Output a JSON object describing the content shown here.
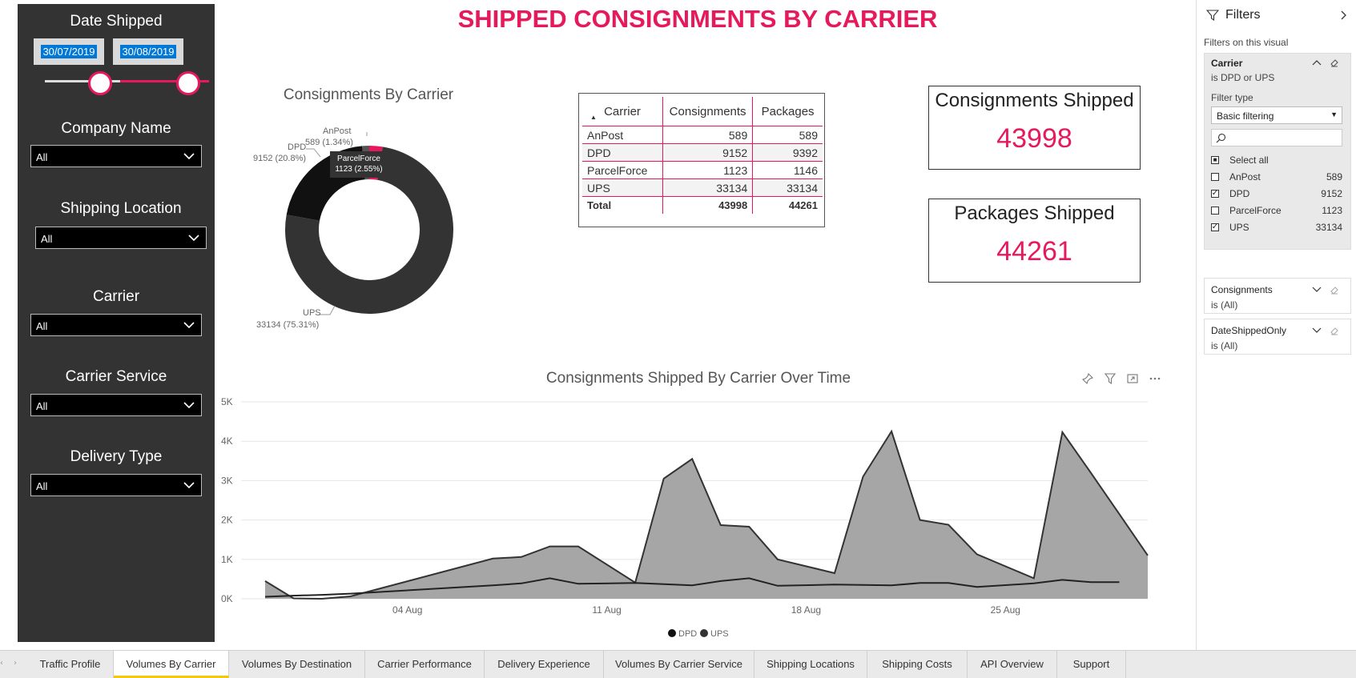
{
  "page_title": "SHIPPED CONSIGNMENTS BY CARRIER",
  "slicers": {
    "date_shipped": {
      "label": "Date Shipped",
      "start": "30/07/2019",
      "end": "30/08/2019"
    },
    "company_name": {
      "label": "Company Name",
      "value": "All"
    },
    "shipping_location": {
      "label": "Shipping Location",
      "value": "All"
    },
    "carrier": {
      "label": "Carrier",
      "value": "All"
    },
    "carrier_service": {
      "label": "Carrier Service",
      "value": "All"
    },
    "delivery_type": {
      "label": "Delivery Type",
      "value": "All"
    }
  },
  "donut": {
    "title": "Consignments By Carrier",
    "tooltip_name": "ParcelForce",
    "tooltip_value": "1123 (2.55%)",
    "labels": {
      "anpost_name": "AnPost",
      "anpost_value": "589 (1.34%)",
      "dpd_name": "DPD",
      "dpd_value": "9152 (20.8%)",
      "ups_name": "UPS",
      "ups_value": "33134 (75.31%)"
    }
  },
  "table": {
    "headers": [
      "Carrier",
      "Consignments",
      "Packages"
    ],
    "rows": [
      {
        "carrier": "AnPost",
        "consignments": "589",
        "packages": "589"
      },
      {
        "carrier": "DPD",
        "consignments": "9152",
        "packages": "9392"
      },
      {
        "carrier": "ParcelForce",
        "consignments": "1123",
        "packages": "1146"
      },
      {
        "carrier": "UPS",
        "consignments": "33134",
        "packages": "33134"
      }
    ],
    "total": {
      "label": "Total",
      "consignments": "43998",
      "packages": "44261"
    }
  },
  "kpis": {
    "consignments": {
      "label": "Consignments Shipped",
      "value": "43998"
    },
    "packages": {
      "label": "Packages Shipped",
      "value": "44261"
    }
  },
  "area_chart": {
    "title": "Consignments Shipped By Carrier Over Time",
    "legend": [
      "DPD",
      "UPS"
    ]
  },
  "chart_data": {
    "type": "area",
    "title": "Consignments Shipped By Carrier Over Time",
    "x_ticks": [
      "04 Aug",
      "11 Aug",
      "18 Aug",
      "25 Aug"
    ],
    "y_ticks": [
      "0K",
      "1K",
      "2K",
      "3K",
      "4K",
      "5K"
    ],
    "ylim": [
      0,
      5000
    ],
    "x": [
      "30 Jul",
      "31 Jul",
      "01 Aug",
      "02 Aug",
      "07 Aug",
      "08 Aug",
      "09 Aug",
      "10 Aug",
      "12 Aug",
      "13 Aug",
      "14 Aug",
      "15 Aug",
      "16 Aug",
      "17 Aug",
      "19 Aug",
      "20 Aug",
      "21 Aug",
      "22 Aug",
      "23 Aug",
      "24 Aug",
      "26 Aug",
      "27 Aug",
      "28 Aug",
      "29 Aug",
      "30 Aug"
    ],
    "series": [
      {
        "name": "DPD",
        "values": [
          50,
          80,
          100,
          130,
          340,
          390,
          520,
          380,
          400,
          370,
          340,
          450,
          520,
          330,
          360,
          350,
          340,
          400,
          400,
          300,
          390,
          480,
          420,
          420,
          null
        ]
      },
      {
        "name": "UPS",
        "values": [
          450,
          10,
          0,
          60,
          1020,
          1060,
          1330,
          1330,
          410,
          3050,
          3550,
          1870,
          1830,
          1000,
          650,
          3100,
          4250,
          2000,
          1880,
          1130,
          520,
          4230,
          3200,
          2150,
          1100
        ]
      }
    ],
    "colors": {
      "UPS": "#a6a6a6",
      "DPD": "#595959"
    },
    "grid": true,
    "legend_position": "bottom"
  },
  "filters_pane": {
    "title": "Filters",
    "section": "Filters on this visual",
    "carrier_card": {
      "name": "Carrier",
      "condition": "is DPD or UPS",
      "filter_type_label": "Filter type",
      "filter_type": "Basic filtering",
      "select_all": "Select all",
      "options": [
        {
          "name": "AnPost",
          "count": "589",
          "checked": false
        },
        {
          "name": "DPD",
          "count": "9152",
          "checked": true
        },
        {
          "name": "ParcelForce",
          "count": "1123",
          "checked": false
        },
        {
          "name": "UPS",
          "count": "33134",
          "checked": true
        }
      ]
    },
    "consignments_card": {
      "name": "Consignments",
      "condition": "is (All)"
    },
    "date_card": {
      "name": "DateShippedOnly",
      "condition": "is (All)"
    }
  },
  "tabs": [
    "Traffic Profile",
    "Volumes By Carrier",
    "Volumes By Destination",
    "Carrier Performance",
    "Delivery Experience",
    "Volumes By Carrier Service",
    "Shipping Locations",
    "Shipping Costs",
    "API Overview",
    "Support"
  ],
  "active_tab": "Volumes By Carrier",
  "colors": {
    "accent": "#e6195c",
    "panel": "#333333"
  }
}
